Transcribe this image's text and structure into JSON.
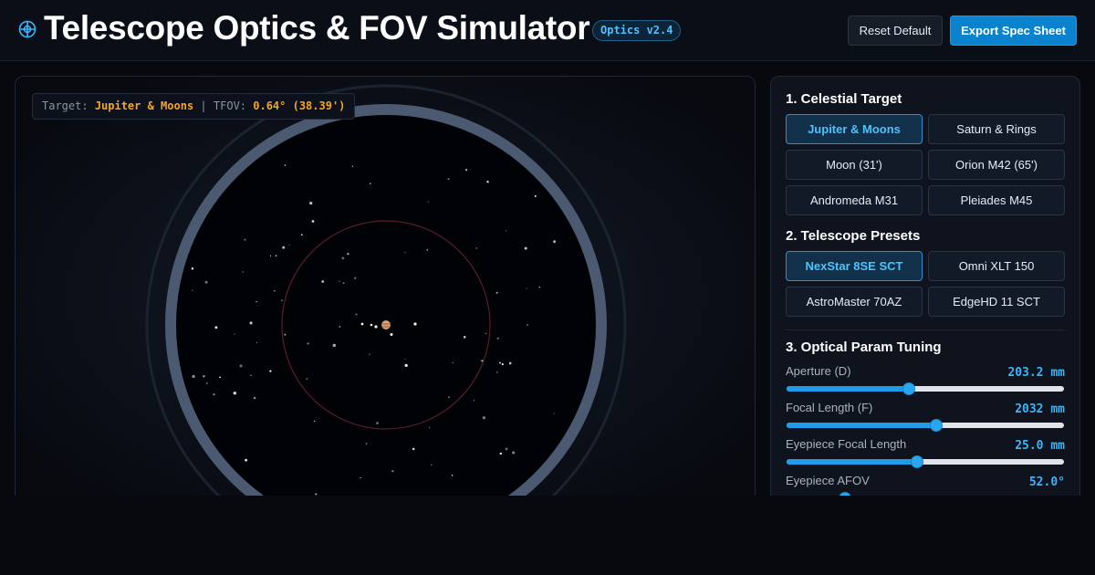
{
  "header": {
    "title": "Telescope Optics & FOV Simulator",
    "version": "Optics v2.4",
    "reset_label": "Reset Default",
    "export_label": "Export Spec Sheet",
    "logo_icon": "crosshair-target-icon"
  },
  "viewport": {
    "target_prefix": "Target:",
    "target_name": "Jupiter & Moons",
    "separator": "|",
    "tfov_prefix": "TFOV:",
    "tfov_value": "0.64° (38.39')"
  },
  "panel": {
    "targets": {
      "title": "1. Celestial Target",
      "selected": "Jupiter & Moons",
      "options": [
        "Jupiter & Moons",
        "Saturn & Rings",
        "Moon (31')",
        "Orion M42 (65')",
        "Andromeda M31",
        "Pleiades M45"
      ]
    },
    "presets": {
      "title": "2. Telescope Presets",
      "selected": "NexStar 8SE SCT",
      "options": [
        "NexStar 8SE SCT",
        "Omni XLT 150",
        "AstroMaster 70AZ",
        "EdgeHD 11 SCT"
      ]
    },
    "params": {
      "title": "3. Optical Param Tuning",
      "items": [
        {
          "label": "Aperture (D)",
          "value": "203.2 mm",
          "level": 0.44
        },
        {
          "label": "Focal Length (F)",
          "value": "2032 mm",
          "level": 0.54
        },
        {
          "label": "Eyepiece Focal Length",
          "value": "25.0 mm",
          "level": 0.47
        },
        {
          "label": "Eyepiece AFOV",
          "value": "52.0°",
          "level": 0.21
        }
      ]
    }
  },
  "colors": {
    "accent": "#38b6ff",
    "primary_button": "#0b82cd",
    "highlight": "#f5a524",
    "jupiter": "#d9a07a"
  }
}
